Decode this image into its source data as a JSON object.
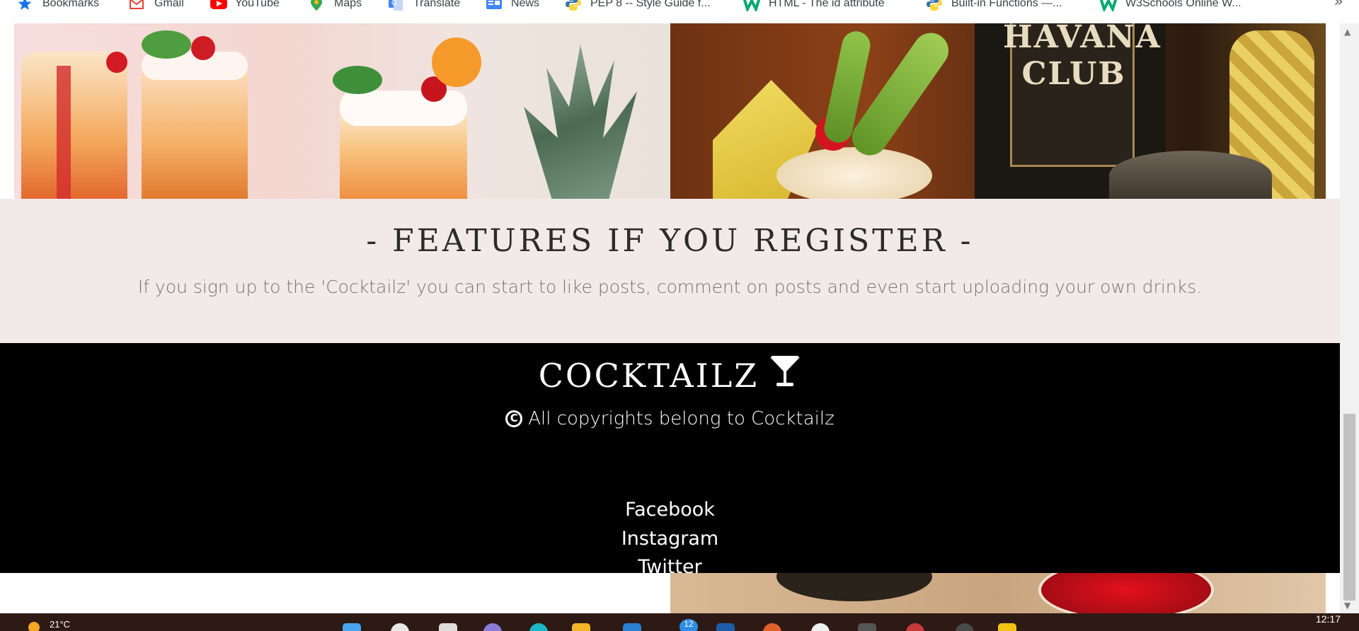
{
  "bookmarks": [
    {
      "label": "Bookmarks",
      "icon": "star-icon"
    },
    {
      "label": "Gmail",
      "icon": "gmail-icon"
    },
    {
      "label": "YouTube",
      "icon": "youtube-icon"
    },
    {
      "label": "Maps",
      "icon": "maps-icon"
    },
    {
      "label": "Translate",
      "icon": "translate-icon"
    },
    {
      "label": "News",
      "icon": "news-icon"
    },
    {
      "label": "PEP 8 -- Style Guide f...",
      "icon": "python-icon"
    },
    {
      "label": "HTML - The id attribute",
      "icon": "w3schools-icon"
    },
    {
      "label": "Built-in Functions —...",
      "icon": "python-icon"
    },
    {
      "label": "W3Schools Online W...",
      "icon": "w3schools-icon"
    }
  ],
  "bookmarks_overflow": "»",
  "features": {
    "title": "- Features if you register -",
    "text": "If you sign up to the 'Cocktailz' you can start to like posts, comment on posts and even start uploading your own drinks."
  },
  "footer": {
    "brand": "Cocktailz",
    "copyright": "All copyrights belong to Cocktailz",
    "links": [
      "Facebook",
      "Instagram",
      "Twitter"
    ]
  },
  "taskbar": {
    "weather": "21°C",
    "time": "12:17",
    "notification_badge": "12"
  }
}
